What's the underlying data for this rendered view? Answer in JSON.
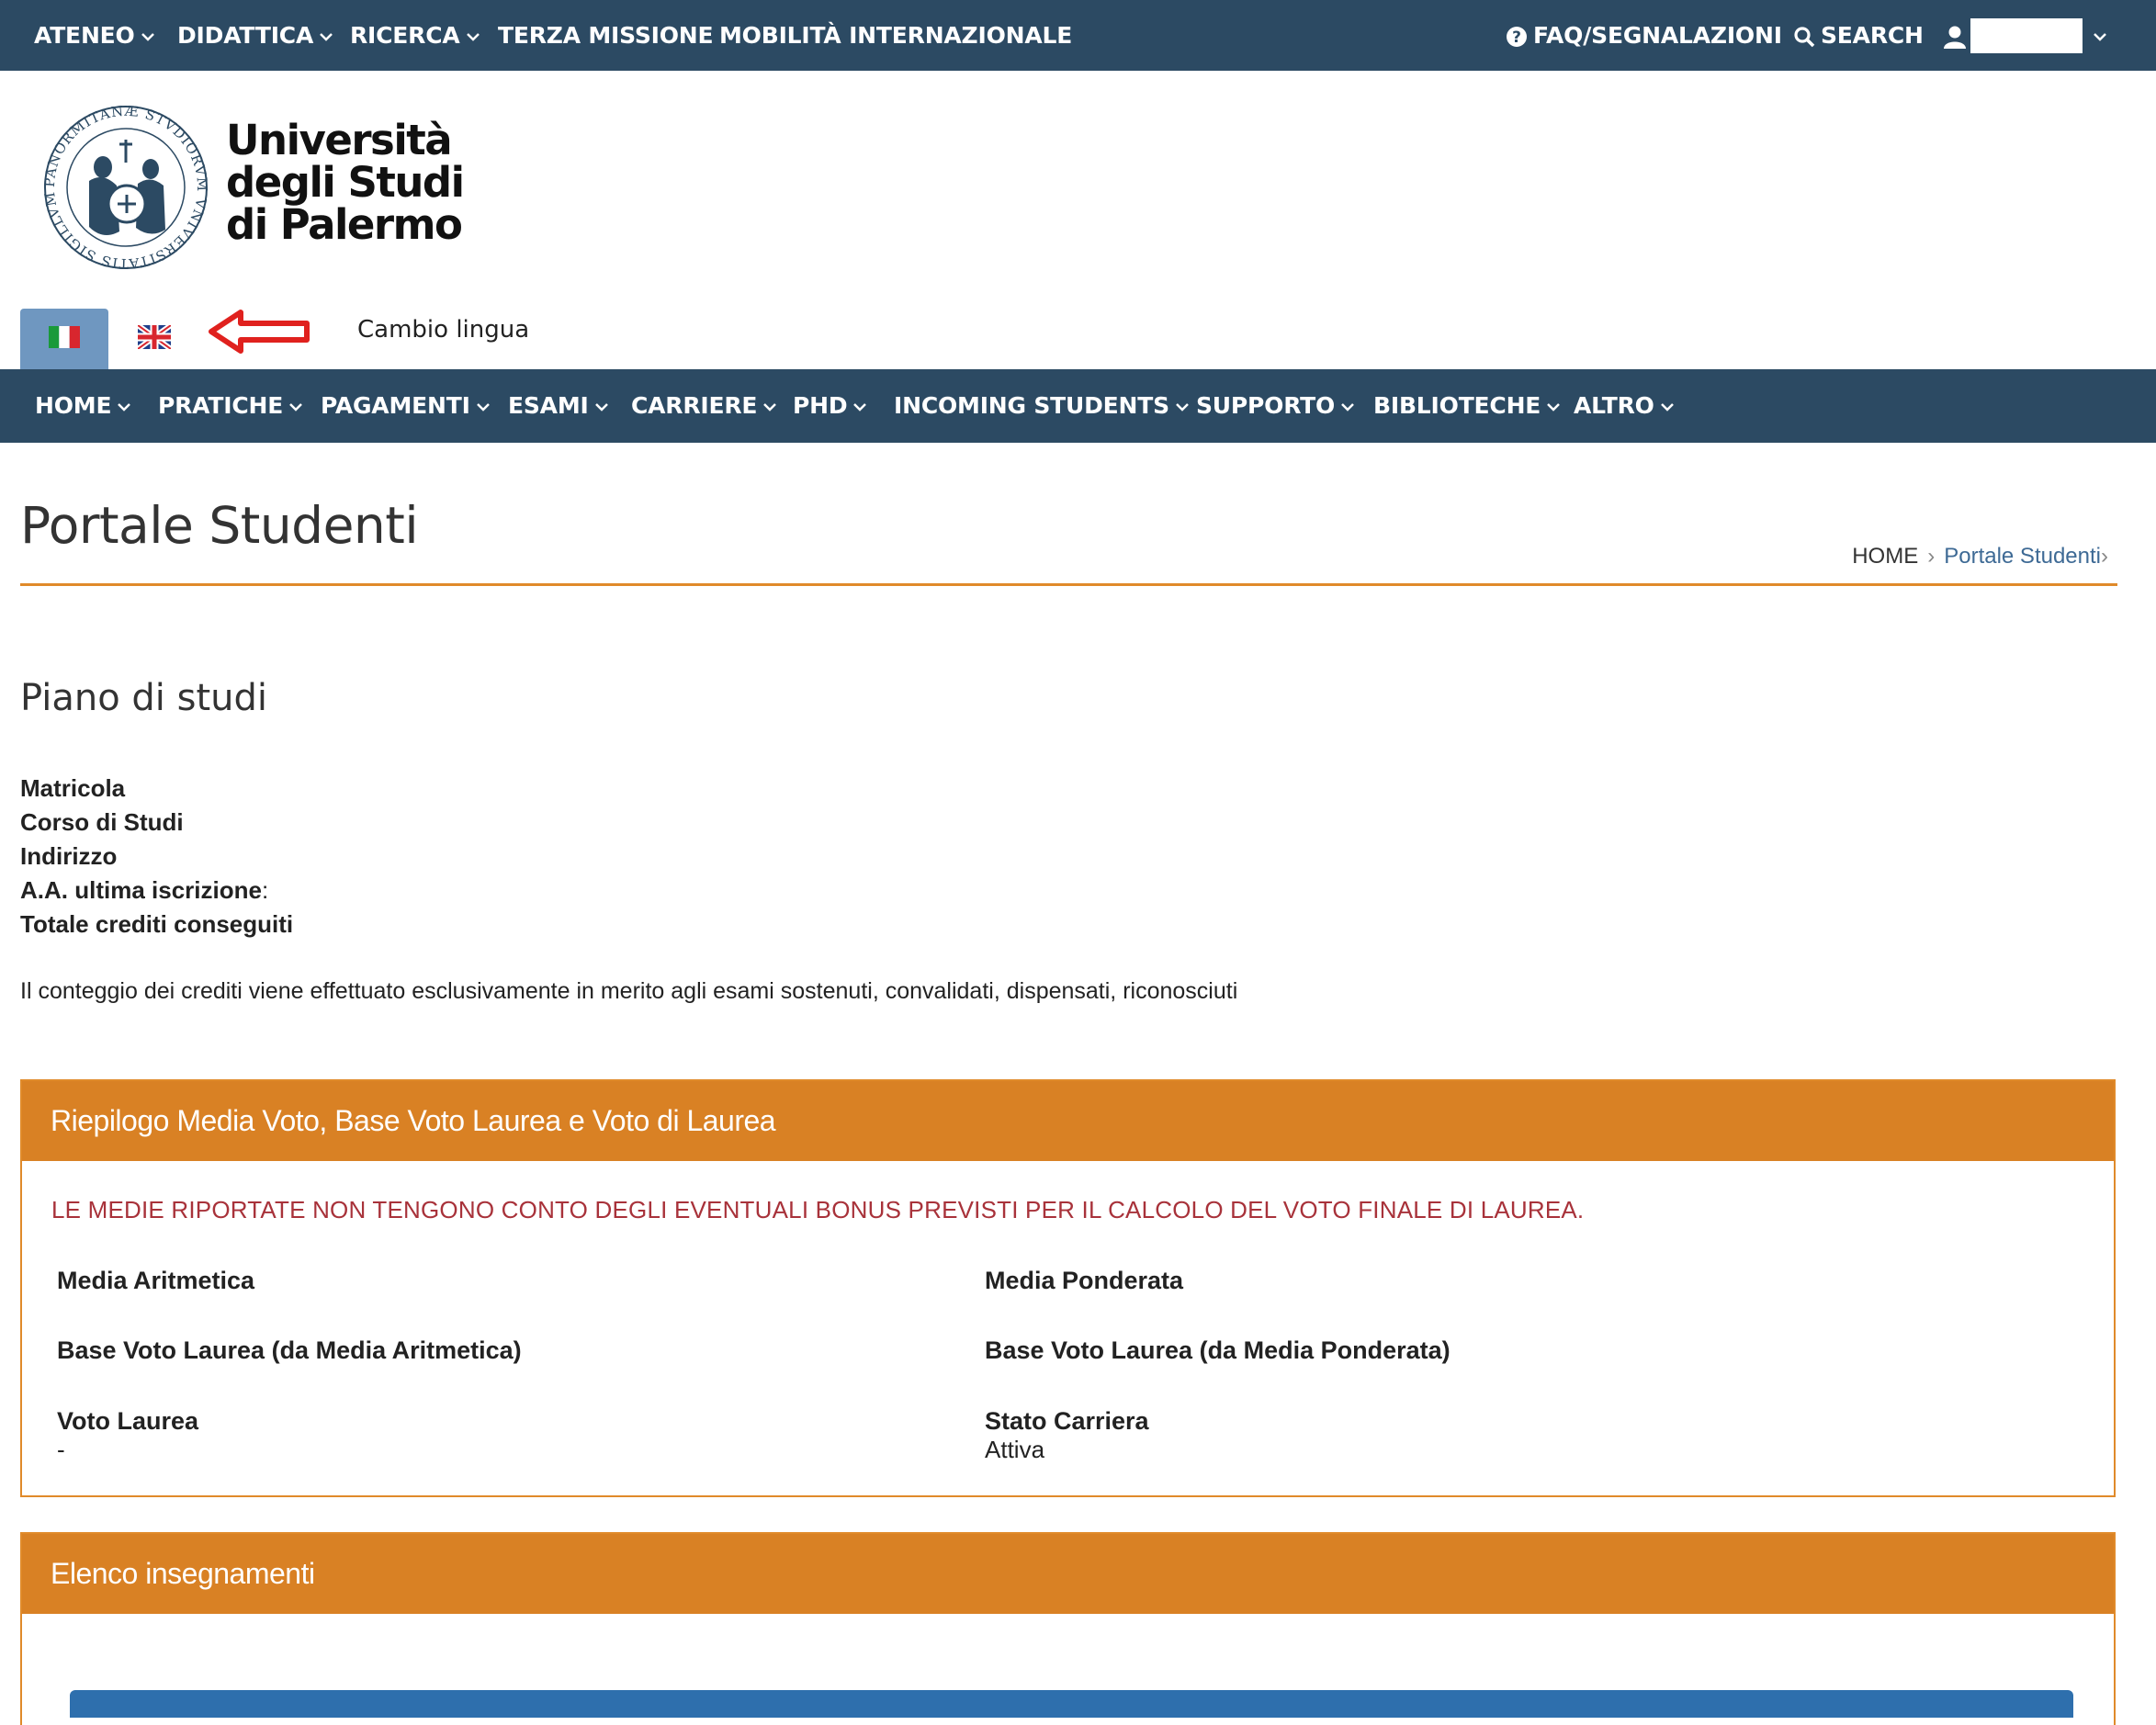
{
  "top_nav": {
    "items": [
      {
        "label": "ATENEO",
        "has_dropdown": true
      },
      {
        "label": "DIDATTICA",
        "has_dropdown": true
      },
      {
        "label": "RICERCA",
        "has_dropdown": true
      },
      {
        "label": "TERZA MISSIONE",
        "has_dropdown": false
      },
      {
        "label": "MOBILITÀ INTERNAZIONALE",
        "has_dropdown": false
      }
    ],
    "faq_label": "FAQ/SEGNALAZIONI",
    "search_label": "SEARCH",
    "user_label": ""
  },
  "logo": {
    "line1": "Università",
    "line2": "degli Studi",
    "line3": "di Palermo",
    "seal_text": "PANORMITANÆ STVDIORVM VNIVERSITATIS SIGILLVM"
  },
  "language": {
    "label": "Cambio lingua",
    "options": [
      "it-flag-icon",
      "uk-flag-icon"
    ]
  },
  "main_nav": {
    "items": [
      {
        "label": "HOME"
      },
      {
        "label": "PRATICHE"
      },
      {
        "label": "PAGAMENTI"
      },
      {
        "label": "ESAMI"
      },
      {
        "label": "CARRIERE"
      },
      {
        "label": "PHD"
      },
      {
        "label": "INCOMING STUDENTS"
      },
      {
        "label": "SUPPORTO"
      },
      {
        "label": "BIBLIOTECHE"
      },
      {
        "label": "ALTRO"
      }
    ]
  },
  "page": {
    "title": "Portale Studenti",
    "breadcrumb": {
      "home": "HOME",
      "current": "Portale Studenti"
    }
  },
  "section": {
    "title": "Piano di studi",
    "fields": {
      "matricola": "Matricola",
      "corso": "Corso di Studi",
      "indirizzo": "Indirizzo",
      "aa_iscrizione": "A.A. ultima iscrizione",
      "aa_colon": ":",
      "crediti": "Totale crediti conseguiti"
    },
    "note": "Il conteggio dei crediti viene effettuato esclusivamente in merito agli esami sostenuti, convalidati, dispensati, riconosciuti"
  },
  "riepilogo": {
    "title": "Riepilogo Media Voto, Base Voto Laurea e Voto di Laurea",
    "warning": "LE MEDIE RIPORTATE NON TENGONO CONTO DEGLI EVENTUALI BONUS PREVISTI PER IL CALCOLO DEL VOTO FINALE DI LAUREA.",
    "media_aritmetica_label": "Media Aritmetica",
    "media_ponderata_label": "Media Ponderata",
    "base_aritmetica_label": "Base Voto Laurea (da Media Aritmetica)",
    "base_ponderata_label": "Base Voto Laurea (da Media Ponderata)",
    "voto_laurea_label": "Voto Laurea",
    "voto_laurea_value": "-",
    "stato_carriera_label": "Stato Carriera",
    "stato_carriera_value": "Attiva"
  },
  "insegnamenti": {
    "title": "Elenco insegnamenti"
  },
  "colors": {
    "nav_bg": "#2c4a63",
    "accent_orange": "#d98124",
    "warning_red": "#a8323a",
    "link_blue": "#3e6a95",
    "table_header_blue": "#2e6fad"
  }
}
